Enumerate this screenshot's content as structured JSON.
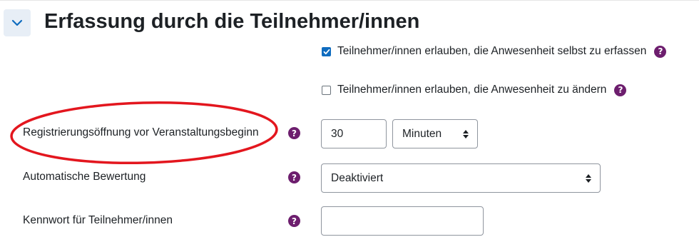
{
  "section": {
    "title": "Erfassung durch die Teilnehmer/innen",
    "collapse_icon": "chevron-down-icon"
  },
  "options": {
    "self_marking": {
      "label": "Teilnehmer/innen erlauben, die Anwesenheit selbst zu erfassen",
      "checked": true
    },
    "allow_change": {
      "label": "Teilnehmer/innen erlauben, die Anwesenheit zu ändern",
      "checked": false
    }
  },
  "fields": {
    "registration_opening": {
      "label": "Registrierungsöffnung vor Veranstaltungsbeginn",
      "value": "30",
      "unit": "Minuten"
    },
    "auto_grading": {
      "label": "Automatische Bewertung",
      "value": "Deaktiviert"
    },
    "student_password": {
      "label": "Kennwort für Teilnehmer/innen",
      "value": ""
    }
  },
  "help_glyph": "?",
  "colors": {
    "help_icon": "#6d1e6e",
    "checkbox_checked": "#0f6cbf",
    "annotation_ring": "#e3161e",
    "collapse_button_bg": "#e7eef6"
  }
}
